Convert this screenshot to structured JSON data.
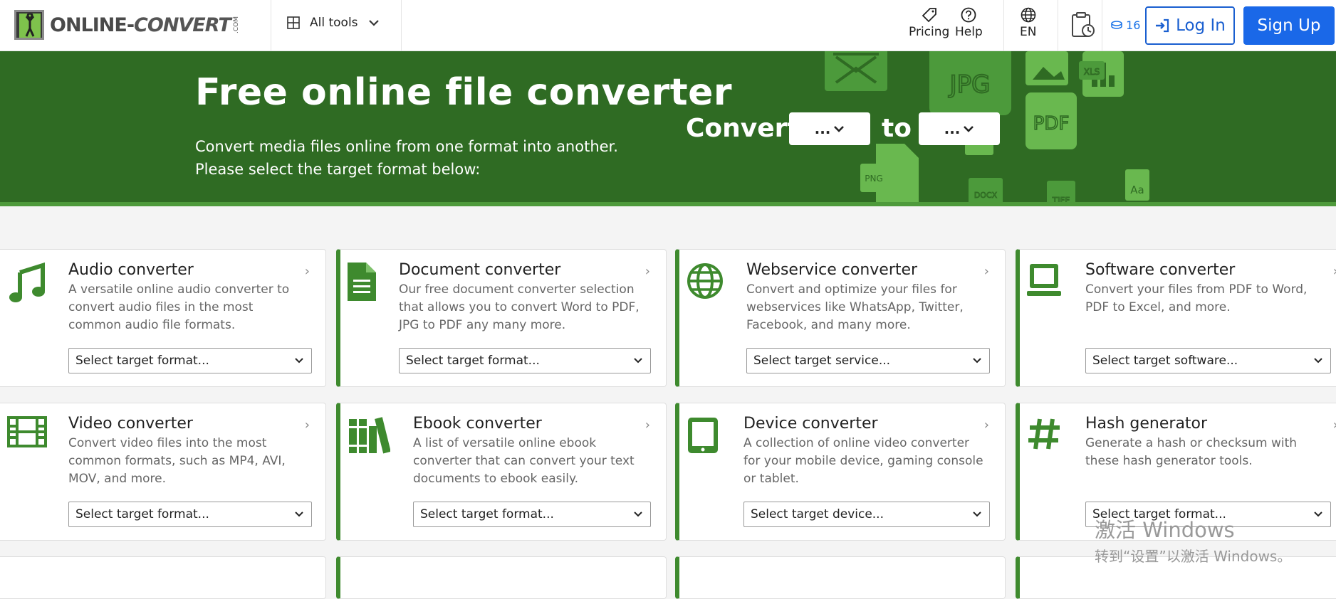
{
  "header": {
    "logo_text_a": "ONLINE-",
    "logo_text_b": "CONVERT",
    "logo_com": ".COM",
    "all_tools": "All tools",
    "pricing": "Pricing",
    "help": "Help",
    "language": "EN",
    "credits": "16",
    "login": "Log In",
    "signup": "Sign Up"
  },
  "hero": {
    "title": "Free online file converter",
    "subtitle": "Convert media files online from one format into another. Please select the target format below:",
    "convert_label": "Convert",
    "to_label": "to",
    "from_value": "...",
    "to_value": "...",
    "art_labels": [
      "JPG",
      "PDF",
      "XLS",
      "PNG",
      "DOCX",
      "TIFF",
      "Aa"
    ]
  },
  "cards": [
    {
      "title": "Audio converter",
      "desc": "A versatile online audio converter to convert audio files in the most common audio file formats.",
      "select": "Select target format...",
      "icon": "music-note-icon"
    },
    {
      "title": "Document converter",
      "desc": "Our free document converter selection that allows you to convert Word to PDF, JPG to PDF any many more.",
      "select": "Select target format...",
      "icon": "document-icon"
    },
    {
      "title": "Webservice converter",
      "desc": "Convert and optimize your files for webservices like WhatsApp, Twitter, Facebook, and many more.",
      "select": "Select target service...",
      "icon": "globe-icon"
    },
    {
      "title": "Software converter",
      "desc": "Convert your files from PDF to Word, PDF to Excel, and more.",
      "select": "Select target software...",
      "icon": "monitor-icon"
    },
    {
      "title": "Video converter",
      "desc": "Convert video files into the most common formats, such as MP4, AVI, MOV, and more.",
      "select": "Select target format...",
      "icon": "film-icon"
    },
    {
      "title": "Ebook converter",
      "desc": "A list of versatile online ebook converter that can convert your text documents to ebook easily.",
      "select": "Select target format...",
      "icon": "books-icon"
    },
    {
      "title": "Device converter",
      "desc": "A collection of online video converter for your mobile device, gaming console or tablet.",
      "select": "Select target device...",
      "icon": "tablet-icon"
    },
    {
      "title": "Hash generator",
      "desc": "Generate a hash or checksum with these hash generator tools.",
      "select": "Select target format...",
      "icon": "hash-icon"
    }
  ],
  "watermark": {
    "line1": "激活 Windows",
    "line2": "转到“设置”以激活 Windows。"
  },
  "colors": {
    "brand_green": "#2f6b23",
    "accent_blue": "#1a68e8",
    "card_accent": "#3e8a2e"
  }
}
